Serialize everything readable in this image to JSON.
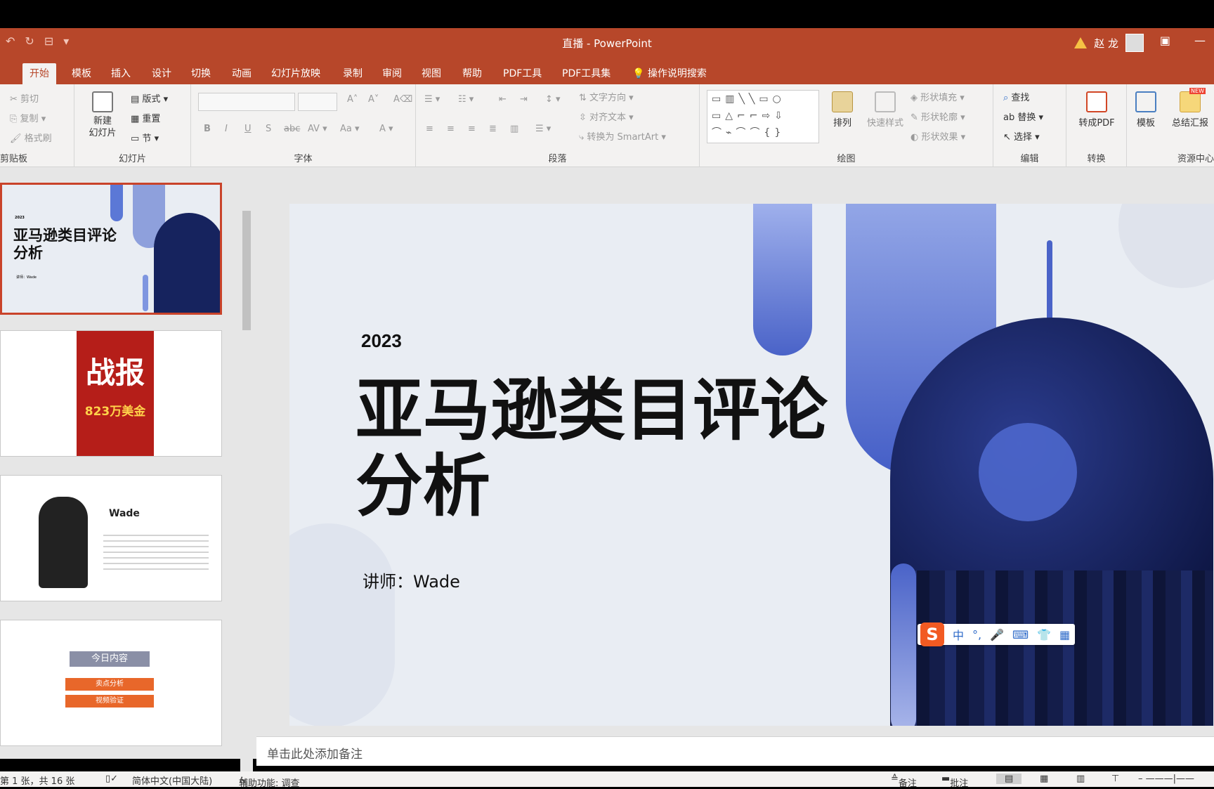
{
  "window": {
    "title": "直播 - PowerPoint",
    "user": "赵 龙"
  },
  "tabs": [
    "开始",
    "模板",
    "插入",
    "设计",
    "切换",
    "动画",
    "幻灯片放映",
    "录制",
    "审阅",
    "视图",
    "帮助",
    "PDF工具",
    "PDF工具集"
  ],
  "search_label": "操作说明搜索",
  "ribbon": {
    "clipboard": {
      "cut": "剪切",
      "copy": "复制",
      "format": "格式刷",
      "label": "剪贴板"
    },
    "slides": {
      "new_slide": "新建\n幻灯片",
      "layout": "版式",
      "reset": "重置",
      "section": "节",
      "label": "幻灯片"
    },
    "font": {
      "label": "字体"
    },
    "paragraph": {
      "text_dir": "文字方向",
      "align_text": "对齐文本",
      "smartart": "转换为 SmartArt",
      "label": "段落"
    },
    "drawing": {
      "arrange": "排列",
      "quick_styles": "快速样式",
      "fill": "形状填充",
      "outline": "形状轮廓",
      "effects": "形状效果",
      "label": "绘图"
    },
    "editing": {
      "find": "查找",
      "replace": "替换",
      "select": "选择",
      "label": "编辑"
    },
    "convert": {
      "to_pdf": "转成PDF",
      "label": "转换"
    },
    "resources": {
      "template": "模板",
      "summary": "总结汇报",
      "label": "资源中心",
      "new_badge": "NEW"
    }
  },
  "slide": {
    "year": "2023",
    "title_line1": "亚马逊类目评论",
    "title_line2": "分析",
    "speaker": "讲师：Wade"
  },
  "thumbnails": {
    "t1_year": "2023",
    "t1_title": "亚马逊类目评论\n分析",
    "t1_speaker": "讲师：Wade",
    "t2_title": "战报",
    "t2_amount": "823万美金",
    "t3_name": "Wade",
    "t4_title": "今日内容",
    "t4_item1": "卖点分析",
    "t4_item2": "视频验证"
  },
  "notes_placeholder": "单击此处添加备注",
  "status": {
    "slide_count": "第 1 张，共 16 张",
    "language": "简体中文(中国大陆)",
    "accessibility": "辅助功能: 调查",
    "notes": "备注",
    "comments": "批注"
  },
  "ime": {
    "mode": "中"
  },
  "colors": {
    "accent": "#b7472a",
    "slide_bg": "#e9edf3",
    "blue": "#4a63c8"
  }
}
